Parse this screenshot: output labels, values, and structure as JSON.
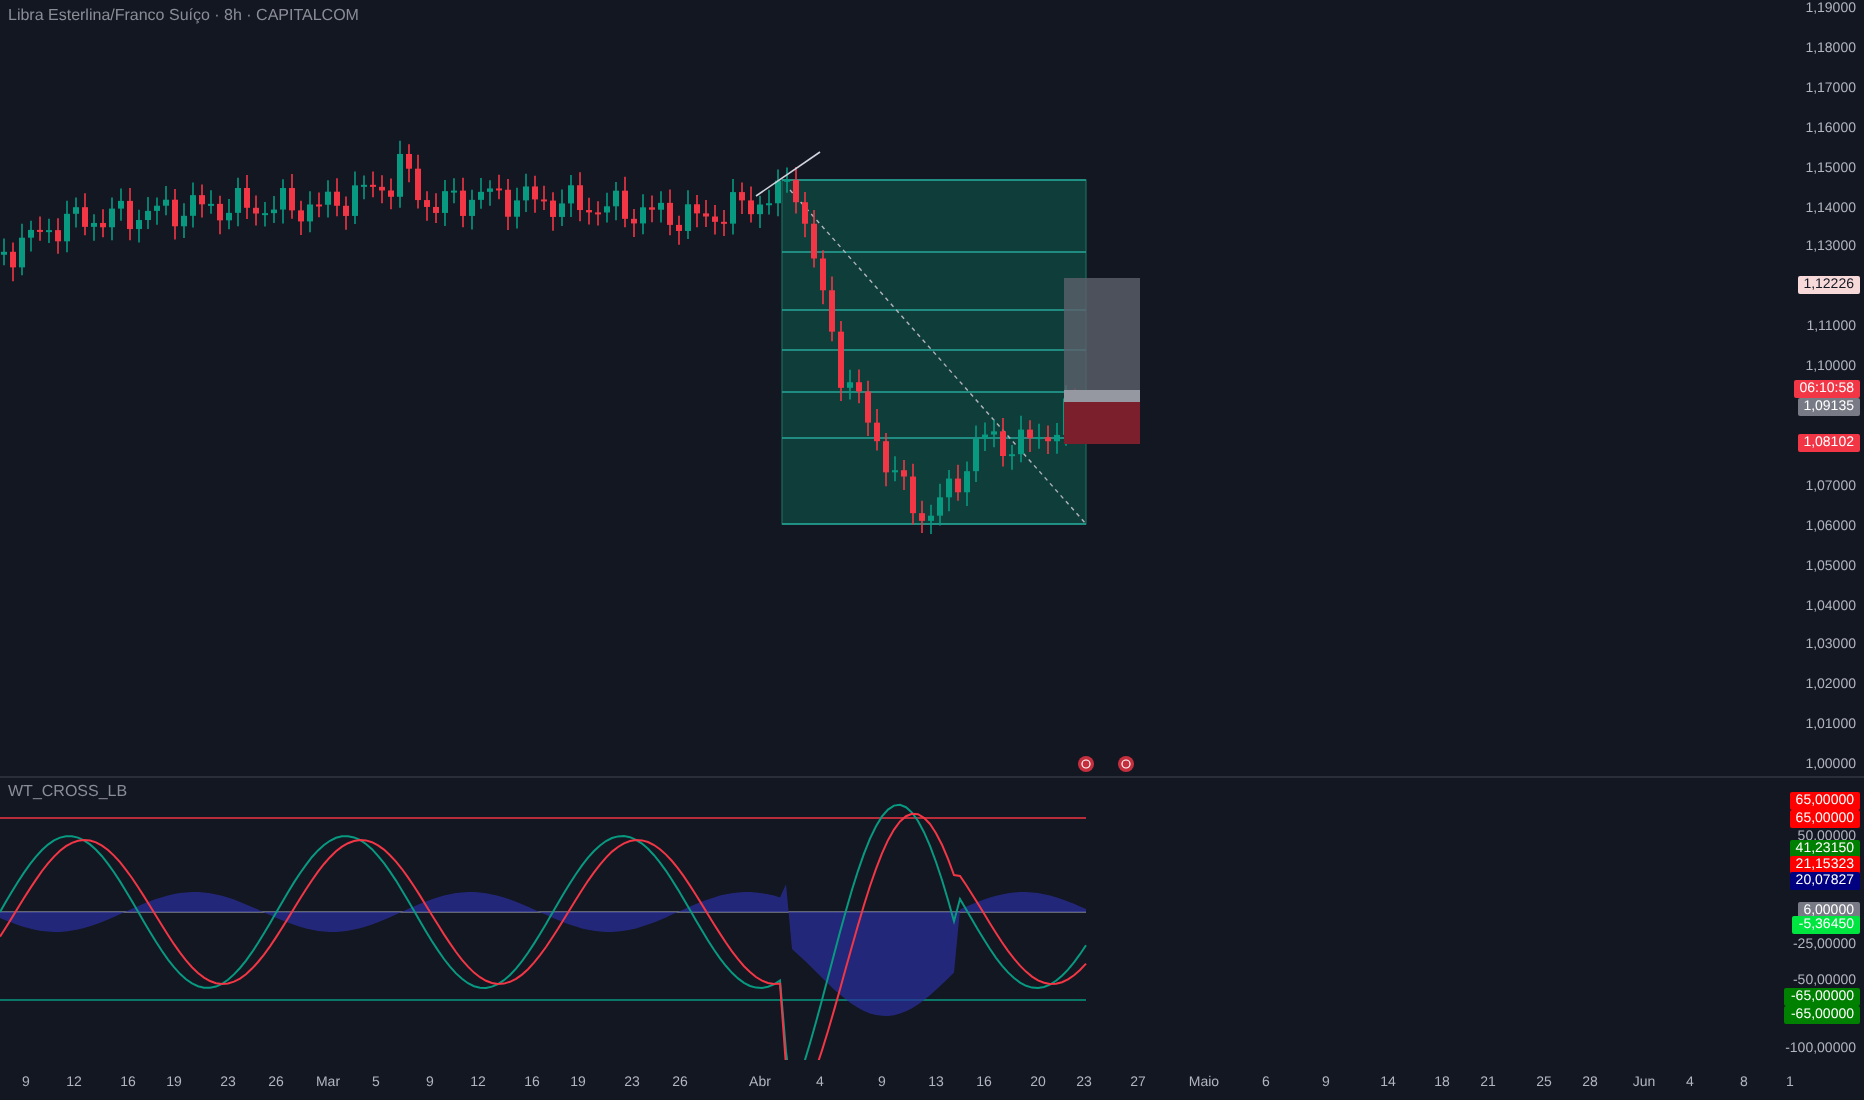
{
  "chart_title": "Libra Esterlina/Franco Suíço · 8h · CAPITALCOM",
  "price_axis": {
    "labels": [
      "1,19000",
      "1,18000",
      "1,17000",
      "1,16000",
      "1,15000",
      "1,14000",
      "1,13000",
      "1,11000",
      "1,10000",
      "1,07000",
      "1,06000",
      "1,05000",
      "1,04000",
      "1,03000",
      "1,02000",
      "1,01000",
      "1,00000"
    ]
  },
  "price_tags": [
    {
      "text": "1,12226",
      "color": "#f7d9d9"
    },
    {
      "text": "06:10:58",
      "color": "#f23645"
    },
    {
      "text": "1,09135",
      "color": "#787b86"
    },
    {
      "text": "1,08102",
      "color": "#f23645"
    }
  ],
  "indicator": {
    "title": "WT_CROSS_LB",
    "axis_labels": [
      "50,00000",
      "-25,00000",
      "-50,00000",
      "-100,00000"
    ],
    "tags": [
      {
        "text": "65,00000",
        "color": "#ff0000"
      },
      {
        "text": "65,00000",
        "color": "#ff0000"
      },
      {
        "text": "41,23150",
        "color": "#008000"
      },
      {
        "text": "21,15323",
        "color": "#ff0000"
      },
      {
        "text": "20,07827",
        "color": "#000080"
      },
      {
        "text": "6,00000",
        "color": "#787b86"
      },
      {
        "text": "-5,36450",
        "color": "#00e640"
      },
      {
        "text": "-65,00000",
        "color": "#008000"
      },
      {
        "text": "-65,00000",
        "color": "#008000"
      }
    ]
  },
  "time_axis": {
    "labels": [
      "9",
      "12",
      "16",
      "19",
      "23",
      "26",
      "Mar",
      "5",
      "9",
      "12",
      "16",
      "19",
      "23",
      "26",
      "Abr",
      "4",
      "9",
      "13",
      "16",
      "20",
      "23",
      "27",
      "Maio",
      "6",
      "9",
      "14",
      "18",
      "21",
      "25",
      "28",
      "Jun",
      "4",
      "8",
      "1"
    ]
  }
}
